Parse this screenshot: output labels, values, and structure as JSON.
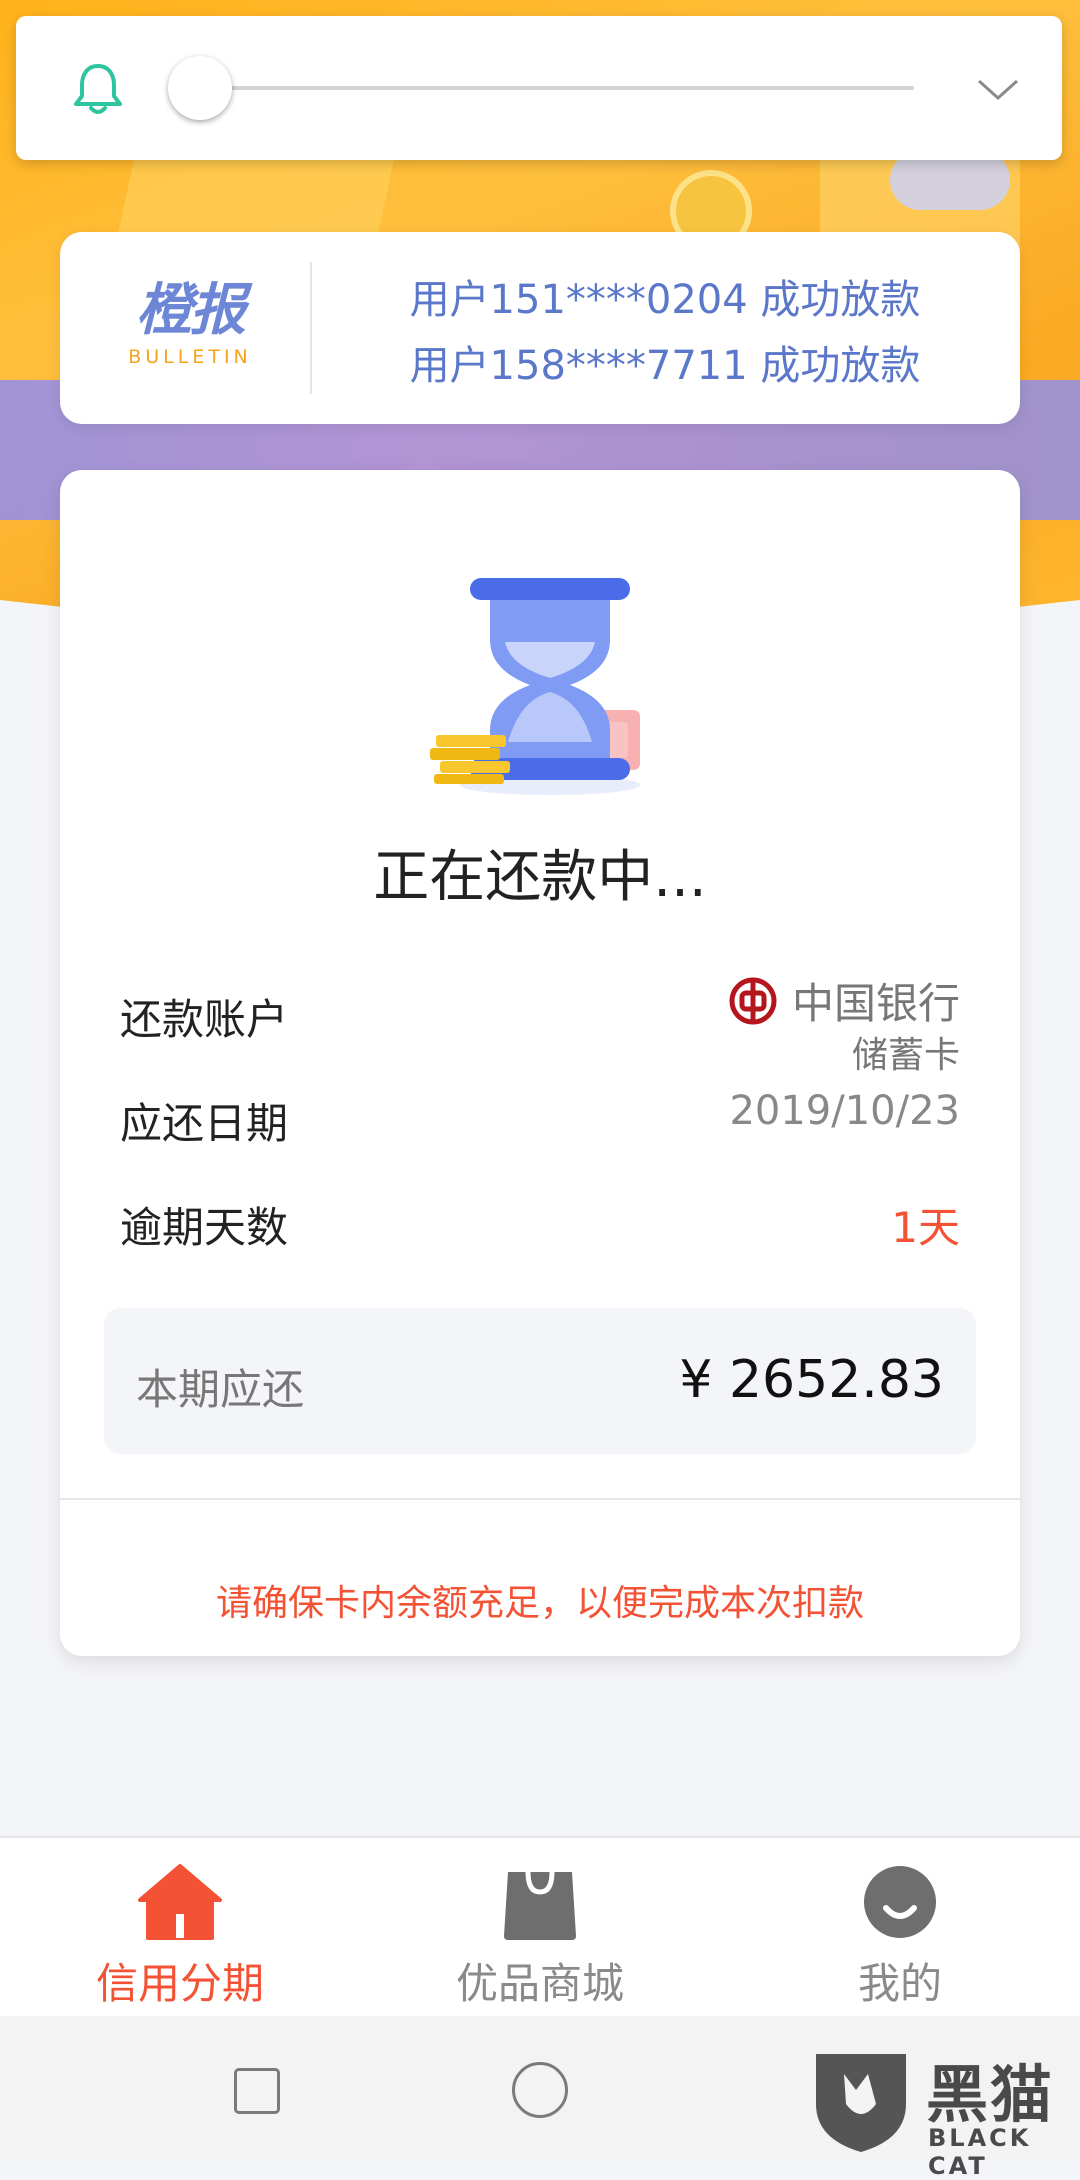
{
  "top_bar": {
    "slider_value_percent": 0
  },
  "bulletin": {
    "logo_cn": "橙报",
    "logo_en": "BULLETIN",
    "messages": [
      "用户151****0204 成功放款",
      "用户158****7711 成功放款"
    ]
  },
  "repayment": {
    "status": "正在还款中...",
    "account_label": "还款账户",
    "bank_name": "中国银行",
    "card_type": "储蓄卡",
    "due_date_label": "应还日期",
    "due_date": "2019/10/23",
    "overdue_label": "逾期天数",
    "overdue_days": "1天",
    "amount_label": "本期应还",
    "amount": "¥ 2652.83",
    "notice": "请确保卡内余额充足，以便完成本次扣款"
  },
  "tabs": [
    {
      "label": "信用分期",
      "icon": "home-icon",
      "active": true
    },
    {
      "label": "优品商城",
      "icon": "shopping-bag-icon",
      "active": false
    },
    {
      "label": "我的",
      "icon": "profile-icon",
      "active": false
    }
  ],
  "watermark": {
    "cn": "黑猫",
    "en": "BLACK CAT"
  },
  "colors": {
    "accent_red": "#f35235",
    "bulletin_blue": "#5b77c9",
    "hero_orange": "#ffb21a",
    "teal_icon": "#2ec4a0"
  }
}
